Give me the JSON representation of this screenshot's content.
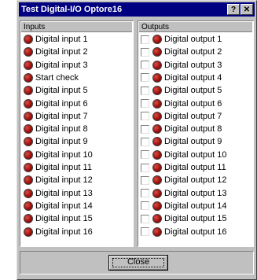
{
  "window": {
    "title": "Test Digital-I/O Optore16",
    "help_label": "?",
    "close_glyph": "✕"
  },
  "inputs": {
    "header": "Inputs",
    "items": [
      "Digital input 1",
      "Digital input 2",
      "Digital input 3",
      "Start check",
      "Digital input 5",
      "Digital input 6",
      "Digital input 7",
      "Digital input 8",
      "Digital input 9",
      "Digital input 10",
      "Digital input 11",
      "Digital input 12",
      "Digital input 13",
      "Digital input 14",
      "Digital input 15",
      "Digital input 16"
    ]
  },
  "outputs": {
    "header": "Outputs",
    "items": [
      "Digital output 1",
      "Digital output 2",
      "Digital output 3",
      "Digital output 4",
      "Digital output 5",
      "Digital output 6",
      "Digital output 7",
      "Digital output 8",
      "Digital output 9",
      "Digital output 10",
      "Digital output 11",
      "Digital output 12",
      "Digital output 13",
      "Digital output 14",
      "Digital output 15",
      "Digital output 16"
    ]
  },
  "buttons": {
    "close_label": "Close"
  },
  "colors": {
    "titlebar": "#000080",
    "led": "#a01010",
    "face": "#c0c0c0"
  }
}
